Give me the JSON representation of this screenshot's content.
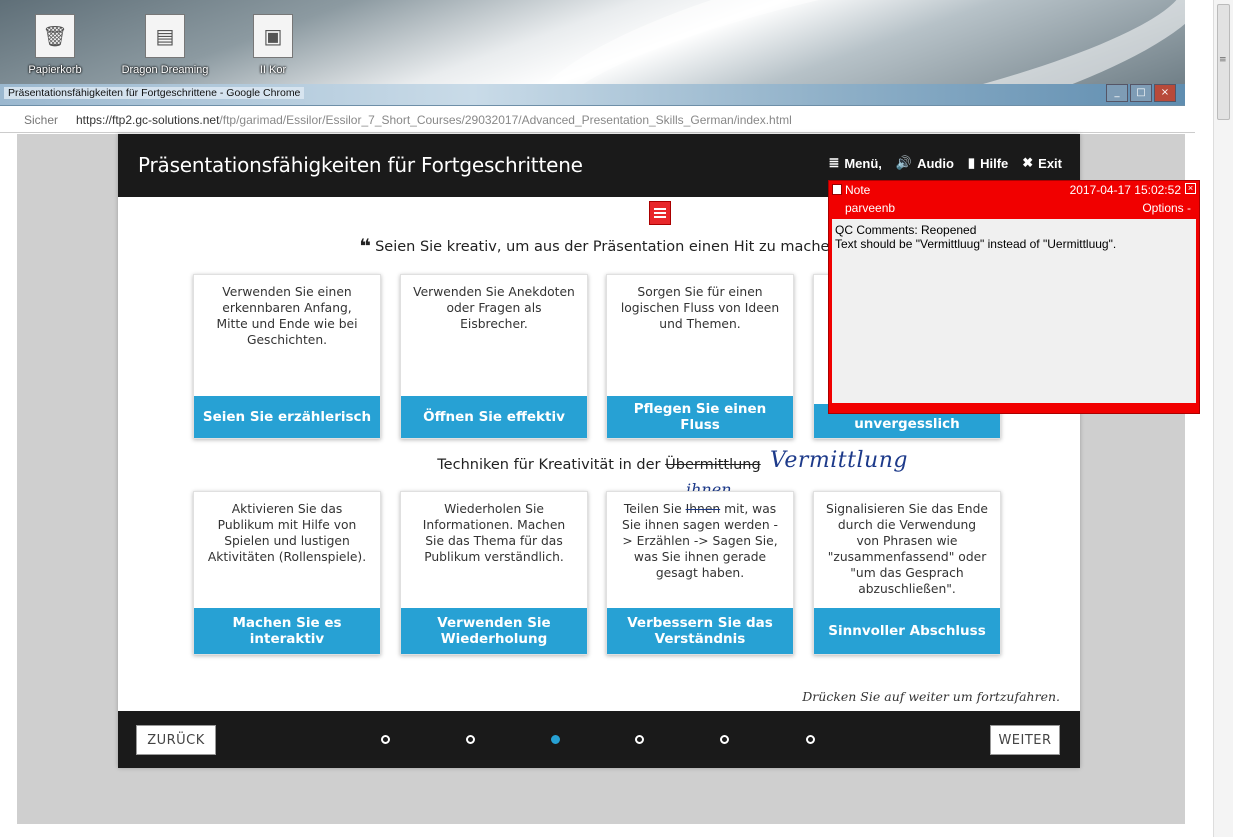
{
  "desktop": {
    "icons": [
      {
        "label": "Papierkorb",
        "icon": "recycle-bin-icon",
        "glyph": "🗑"
      },
      {
        "label": "Dragon Dreaming",
        "icon": "pdf-file-icon",
        "glyph": "▤"
      },
      {
        "label": "II Kor",
        "icon": "image-file-icon",
        "glyph": "▣"
      }
    ]
  },
  "window": {
    "title": "Präsentationsfähigkeiten für Fortgeschrittene - Google Chrome",
    "controls": [
      "_",
      "□",
      "×"
    ]
  },
  "urlbar": {
    "security": "Sicher",
    "url_host": "https://ftp2.gc-solutions.net",
    "url_path": "/ftp/garimad/Essilor/Essilor_7_Short_Courses/29032017/Advanced_Presentation_Skills_German/index.html"
  },
  "course": {
    "title": "Präsentationsfähigkeiten für Fortgeschrittene",
    "nav": [
      {
        "label": "Menü,",
        "icon": "list-icon",
        "glyph": "≣"
      },
      {
        "label": "Audio",
        "icon": "speaker-icon",
        "glyph": "🔊"
      },
      {
        "label": "Hilfe",
        "icon": "book-icon",
        "glyph": "▮"
      },
      {
        "label": "Exit",
        "icon": "close-x-icon",
        "glyph": "✖"
      }
    ],
    "quote": "Seien Sie kreativ, um aus der Präsentation einen Hit zu machen",
    "quote_mark": "❝",
    "row1": [
      {
        "text": "Verwenden Sie einen erkennbaren Anfang, Mitte und Ende wie bei Geschichten.",
        "button": "Seien Sie erzählerisch"
      },
      {
        "text": "Verwenden Sie Anekdoten oder Fragen als Eisbrecher.",
        "button": "Öffnen Sie effektiv"
      },
      {
        "text": "Sorgen Sie für einen logischen Fluss von Ideen und Themen.",
        "button": "Pflegen Sie einen Fluss"
      },
      {
        "text": "",
        "button": "unvergesslich"
      }
    ],
    "section2_prefix": "Techniken für Kreativität in der ",
    "section2_struck": "Übermittlung",
    "handwritten_correction": "Vermittlung",
    "handwritten_ihnen": "ihnen",
    "row2": [
      {
        "text": "Aktivieren Sie das Publikum mit Hilfe von Spielen und lustigen Aktivitäten (Rollenspiele).",
        "button": "Machen Sie es interaktiv"
      },
      {
        "text": "Wiederholen Sie Informationen. Machen Sie das Thema für das Publikum verständlich.",
        "button": "Verwenden Sie Wiederholung"
      },
      {
        "text_before": "Teilen Sie ",
        "text_struck": "Ihnen",
        "text_after": " mit, was Sie ihnen sagen werden -> Erzählen -> Sagen Sie, was Sie ihnen gerade gesagt haben.",
        "button": "Verbessern Sie das Verständnis"
      },
      {
        "text": "Signalisieren Sie das Ende durch die Verwendung von Phrasen wie \"zusammenfassend\" oder \"um das Gesprach abzuschließen\".",
        "button": "Sinnvoller Abschluss"
      }
    ],
    "continue_hint": "Drücken Sie auf weiter um fortzufahren.",
    "back_label": "ZURÜCK",
    "next_label": "WEITER",
    "pages_total": 6,
    "current_page": 3
  },
  "note": {
    "title": "Note",
    "timestamp": "2017-04-17 15:02:52",
    "author": "parveenb",
    "options": "Options -",
    "line1": "QC Comments: Reopened",
    "line2": "Text should be \"Vermittluug\" instead of \"Uermittluug\".",
    "close": "×"
  },
  "colors": {
    "accent": "#27a1d4",
    "header": "#1a1a1a",
    "note": "#f10000"
  }
}
